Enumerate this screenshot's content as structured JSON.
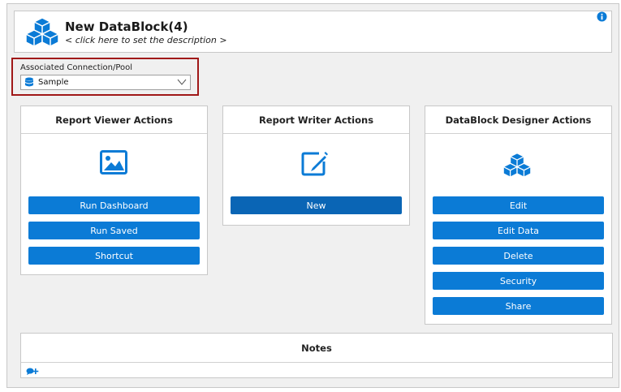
{
  "header": {
    "title": "New DataBlock(4)",
    "description_placeholder": "< click here to set the description >",
    "icon": "datablock-cubes-icon",
    "info_icon": "info-icon"
  },
  "connection": {
    "label": "Associated Connection/Pool",
    "selected": "Sample",
    "icon": "database-icon"
  },
  "panels": {
    "viewer": {
      "title": "Report Viewer Actions",
      "icon": "image-icon",
      "buttons": [
        "Run Dashboard",
        "Run Saved",
        "Shortcut"
      ]
    },
    "writer": {
      "title": "Report Writer Actions",
      "icon": "edit-pencil-icon",
      "buttons": [
        "New"
      ]
    },
    "designer": {
      "title": "DataBlock Designer Actions",
      "icon": "cubes-icon",
      "buttons": [
        "Edit",
        "Edit Data",
        "Delete",
        "Security",
        "Share"
      ]
    }
  },
  "notes": {
    "title": "Notes",
    "add_icon": "add-note-icon"
  },
  "colors": {
    "accent": "#0b7bd6",
    "highlight_border": "#a01818",
    "background": "#f0f0f0"
  }
}
